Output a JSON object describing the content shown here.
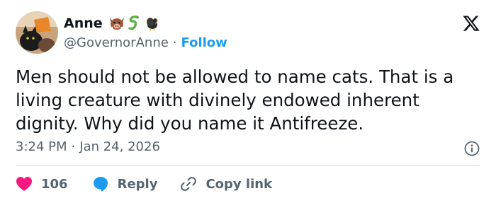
{
  "author": {
    "name": "Anne",
    "handle": "@GovernorAnne",
    "separator": "·",
    "follow_label": "Follow",
    "emoji_icons": [
      "boar-face-icon",
      "snake-icon",
      "turkey-icon"
    ]
  },
  "tweet": {
    "text": "Men should not be allowed to name cats. That is a living creature with divinely endowed inherent dignity. Why did you name it Antifreeze."
  },
  "meta": {
    "time": "3:24 PM",
    "separator": "·",
    "date": "Jan 24, 2026"
  },
  "actions": {
    "like_count": "106",
    "reply_label": "Reply",
    "copy_label": "Copy link"
  },
  "colors": {
    "text": "#0f1419",
    "secondary": "#536471",
    "accent": "#1d9bf0",
    "like": "#f91880",
    "divider": "#cfd9de"
  }
}
